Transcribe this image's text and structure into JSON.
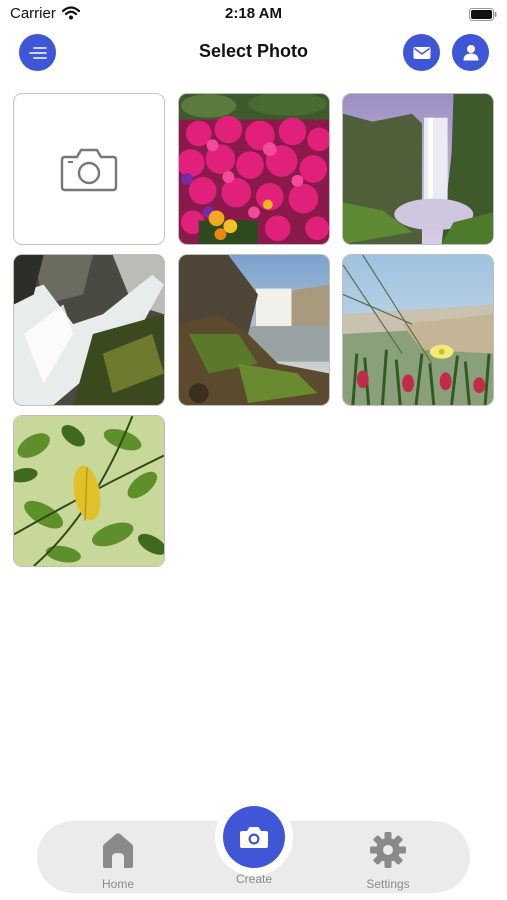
{
  "status_bar": {
    "carrier": "Carrier",
    "time": "2:18 AM"
  },
  "header": {
    "title": "Select Photo",
    "menu_icon": "menu-lines-icon",
    "mail_icon": "mail-icon",
    "profile_icon": "person-icon"
  },
  "grid": {
    "camera_tile_icon": "camera-outline-icon",
    "photos": [
      {
        "subject": "pink-flowers"
      },
      {
        "subject": "waterfall-cliff"
      },
      {
        "subject": "waterfall-rocks"
      },
      {
        "subject": "waterfall-coast"
      },
      {
        "subject": "ice-plant-dunes"
      },
      {
        "subject": "green-leaves"
      }
    ]
  },
  "tab_bar": {
    "home_label": "Home",
    "create_label": "Create",
    "settings_label": "Settings"
  },
  "colors": {
    "accent": "#3F57D6",
    "tab_bar_bg": "#EBEBEB",
    "inactive": "#8A8A8A"
  }
}
